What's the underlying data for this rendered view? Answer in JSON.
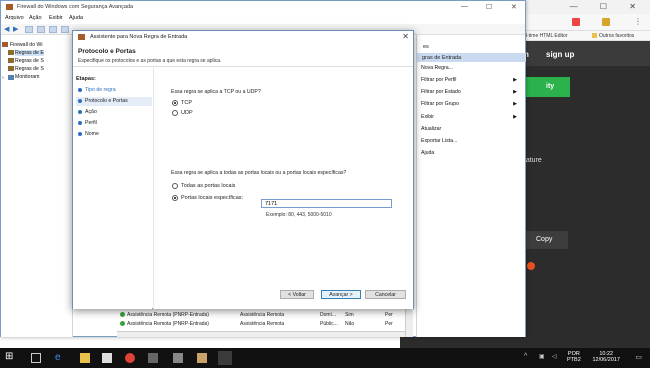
{
  "browser": {
    "bookmark_apps": "Ap",
    "bookmark_html_editor": "l-time HTML Editor",
    "bookmark_other": "Outros favoritos"
  },
  "site": {
    "login": "n",
    "signup": "sign up",
    "green_button_fragment": "ity",
    "mature_label": "Mature",
    "copy_label": "Copy"
  },
  "firewall": {
    "title": "Firewall do Windows com Segurança Avançada",
    "menu": [
      "Arquivo",
      "Ação",
      "Exibir",
      "Ajuda"
    ],
    "tree": [
      "Firewall do Wi",
      "Regras de E",
      "Regras de S",
      "Regras de S",
      "Monitoram"
    ],
    "actions_header_top": "es",
    "actions_header": "gras de Entrada",
    "actions": [
      {
        "label": "Nova Regra...",
        "arrow": false
      },
      {
        "label": "Filtrar por Perfil",
        "arrow": true
      },
      {
        "label": "Filtrar por Estado",
        "arrow": true
      },
      {
        "label": "Filtrar por Grupo",
        "arrow": true
      },
      {
        "label": "Exibir",
        "arrow": true
      },
      {
        "label": "Atualizar",
        "arrow": false
      },
      {
        "label": "Exportar Lista...",
        "arrow": false
      },
      {
        "label": "Ajuda",
        "arrow": false
      }
    ],
    "rules": [
      {
        "name": "Assistência Remota (PNRP-Entrada)",
        "group": "Assistência Remota",
        "profile": "Domí...",
        "enabled": "Sim",
        "action": "Per"
      },
      {
        "name": "Assistência Remota (PNRP-Entrada)",
        "group": "Assistência Remota",
        "profile": "Públic...",
        "enabled": "Não",
        "action": "Per"
      }
    ]
  },
  "dialog": {
    "title": "Assistente para Nova Regra de Entrada",
    "heading": "Protocolo e Portas",
    "subheading": "Especifique os protocolos e as portas a que esta regra se aplica.",
    "steps_label": "Etapas:",
    "steps": [
      "Tipo de regra",
      "Protocolo e Portas",
      "Ação",
      "Perfil",
      "Nome"
    ],
    "q_protocol": "Essa regra se aplica a TCP ou a UDP?",
    "opt_tcp": "TCP",
    "opt_udp": "UDP",
    "q_ports": "Essa regra se aplica a todas as portas locais ou a portas locais específicas?",
    "opt_all_ports": "Todas as portas locais",
    "opt_specific_ports": "Portas locais específicas:",
    "ports_value": "7171",
    "ports_example": "Exemplo: 80, 443, 5000-5010",
    "btn_back": "< Voltar",
    "btn_next": "Avançar >",
    "btn_cancel": "Cancelar"
  },
  "taskbar": {
    "lang": "POR",
    "layout": "PTB2",
    "time": "10:22",
    "date": "12/06/2017"
  },
  "colors": {
    "accent_blue": "#2c6fbf",
    "site_green": "#2bb24c",
    "taskbar": "#111111"
  }
}
